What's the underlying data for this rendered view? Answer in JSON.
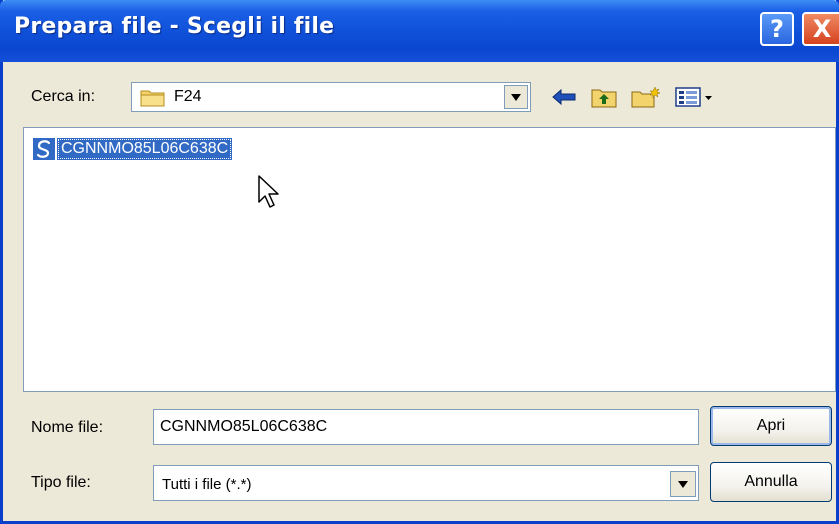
{
  "window": {
    "title": "Prepara file - Scegli il file",
    "help_label": "?",
    "close_label": "X"
  },
  "look_in": {
    "label": "Cerca in:",
    "value": "F24"
  },
  "toolbar": {
    "icons": [
      "back-arrow-icon",
      "up-folder-icon",
      "new-folder-icon",
      "views-menu-icon"
    ]
  },
  "file_list": {
    "items": [
      {
        "name": "CGNNMO85L06C638C",
        "icon": "document-icon",
        "selected": true
      }
    ]
  },
  "file_name": {
    "label": "Nome file:",
    "value": "CGNNMO85L06C638C"
  },
  "file_type": {
    "label": "Tipo file:",
    "value": "Tutti i file (*.*)"
  },
  "buttons": {
    "open_label": "Apri",
    "cancel_label": "Annulla"
  },
  "colors": {
    "titlebar": "#0f4fd8",
    "selection": "#316ac5",
    "dialog_bg": "#ece9d8",
    "close_button": "#d5421e"
  }
}
